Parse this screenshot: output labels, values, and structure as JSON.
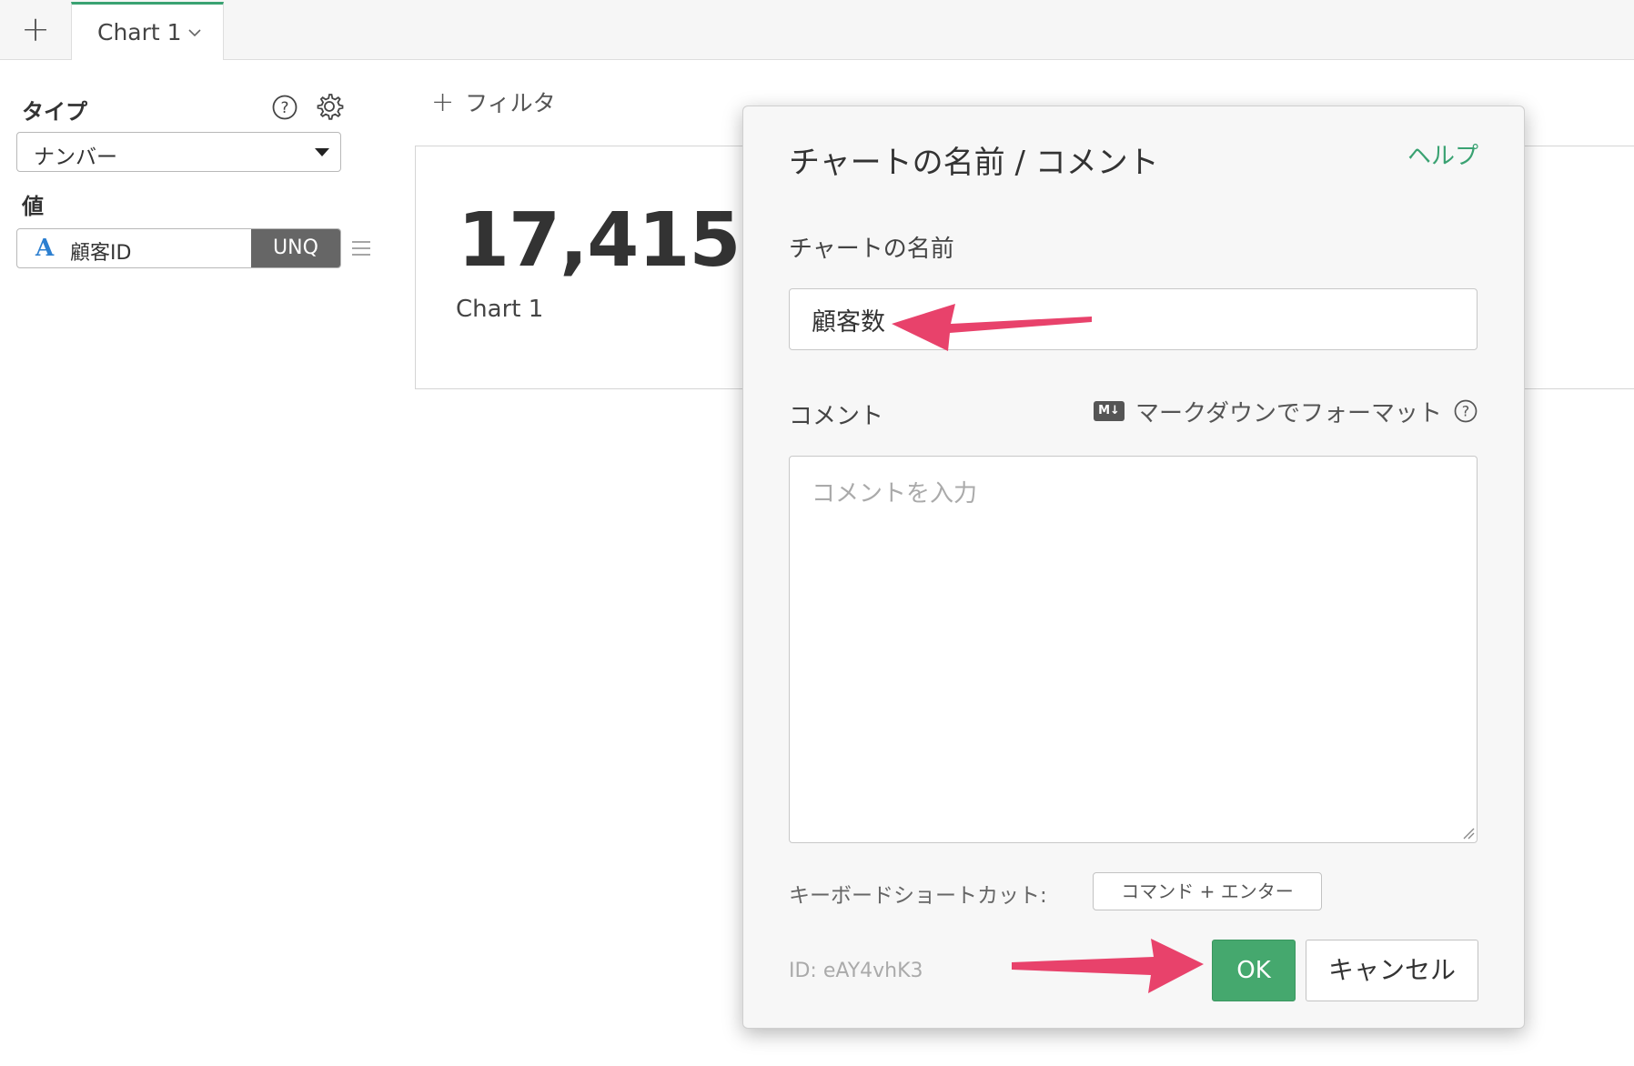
{
  "tabs": {
    "add_label": "+",
    "active_label": "Chart 1"
  },
  "left_panel": {
    "type_label": "タイプ",
    "type_value": "ナンバー",
    "value_label": "値",
    "value_field": "顧客ID",
    "value_type_glyph": "A",
    "aggregation": "UNQ"
  },
  "filter": {
    "plus": "+",
    "label": "フィルタ"
  },
  "chart": {
    "value": "17,415",
    "name": "Chart 1"
  },
  "dialog": {
    "title": "チャートの名前 / コメント",
    "help_link": "ヘルプ",
    "name_label": "チャートの名前",
    "name_value": "顧客数",
    "comment_label": "コメント",
    "markdown_badge": "M↓",
    "markdown_label": "マークダウンでフォーマット",
    "comment_placeholder": "コメントを入力",
    "shortcut_label": "キーボードショートカット:",
    "shortcut_key": "コマンド + エンター",
    "chart_id": "ID: eAY4vhK3",
    "ok_label": "OK",
    "cancel_label": "キャンセル"
  },
  "colors": {
    "accent_green": "#45a86e",
    "annotation_arrow": "#e8426b",
    "type_icon_blue": "#2c7fd0"
  },
  "icons": [
    "plus-icon",
    "chevron-down-icon",
    "help-icon",
    "gear-icon",
    "caret-down-icon",
    "drag-handle-icon",
    "markdown-icon",
    "resize-grip-icon",
    "annotation-arrow"
  ]
}
